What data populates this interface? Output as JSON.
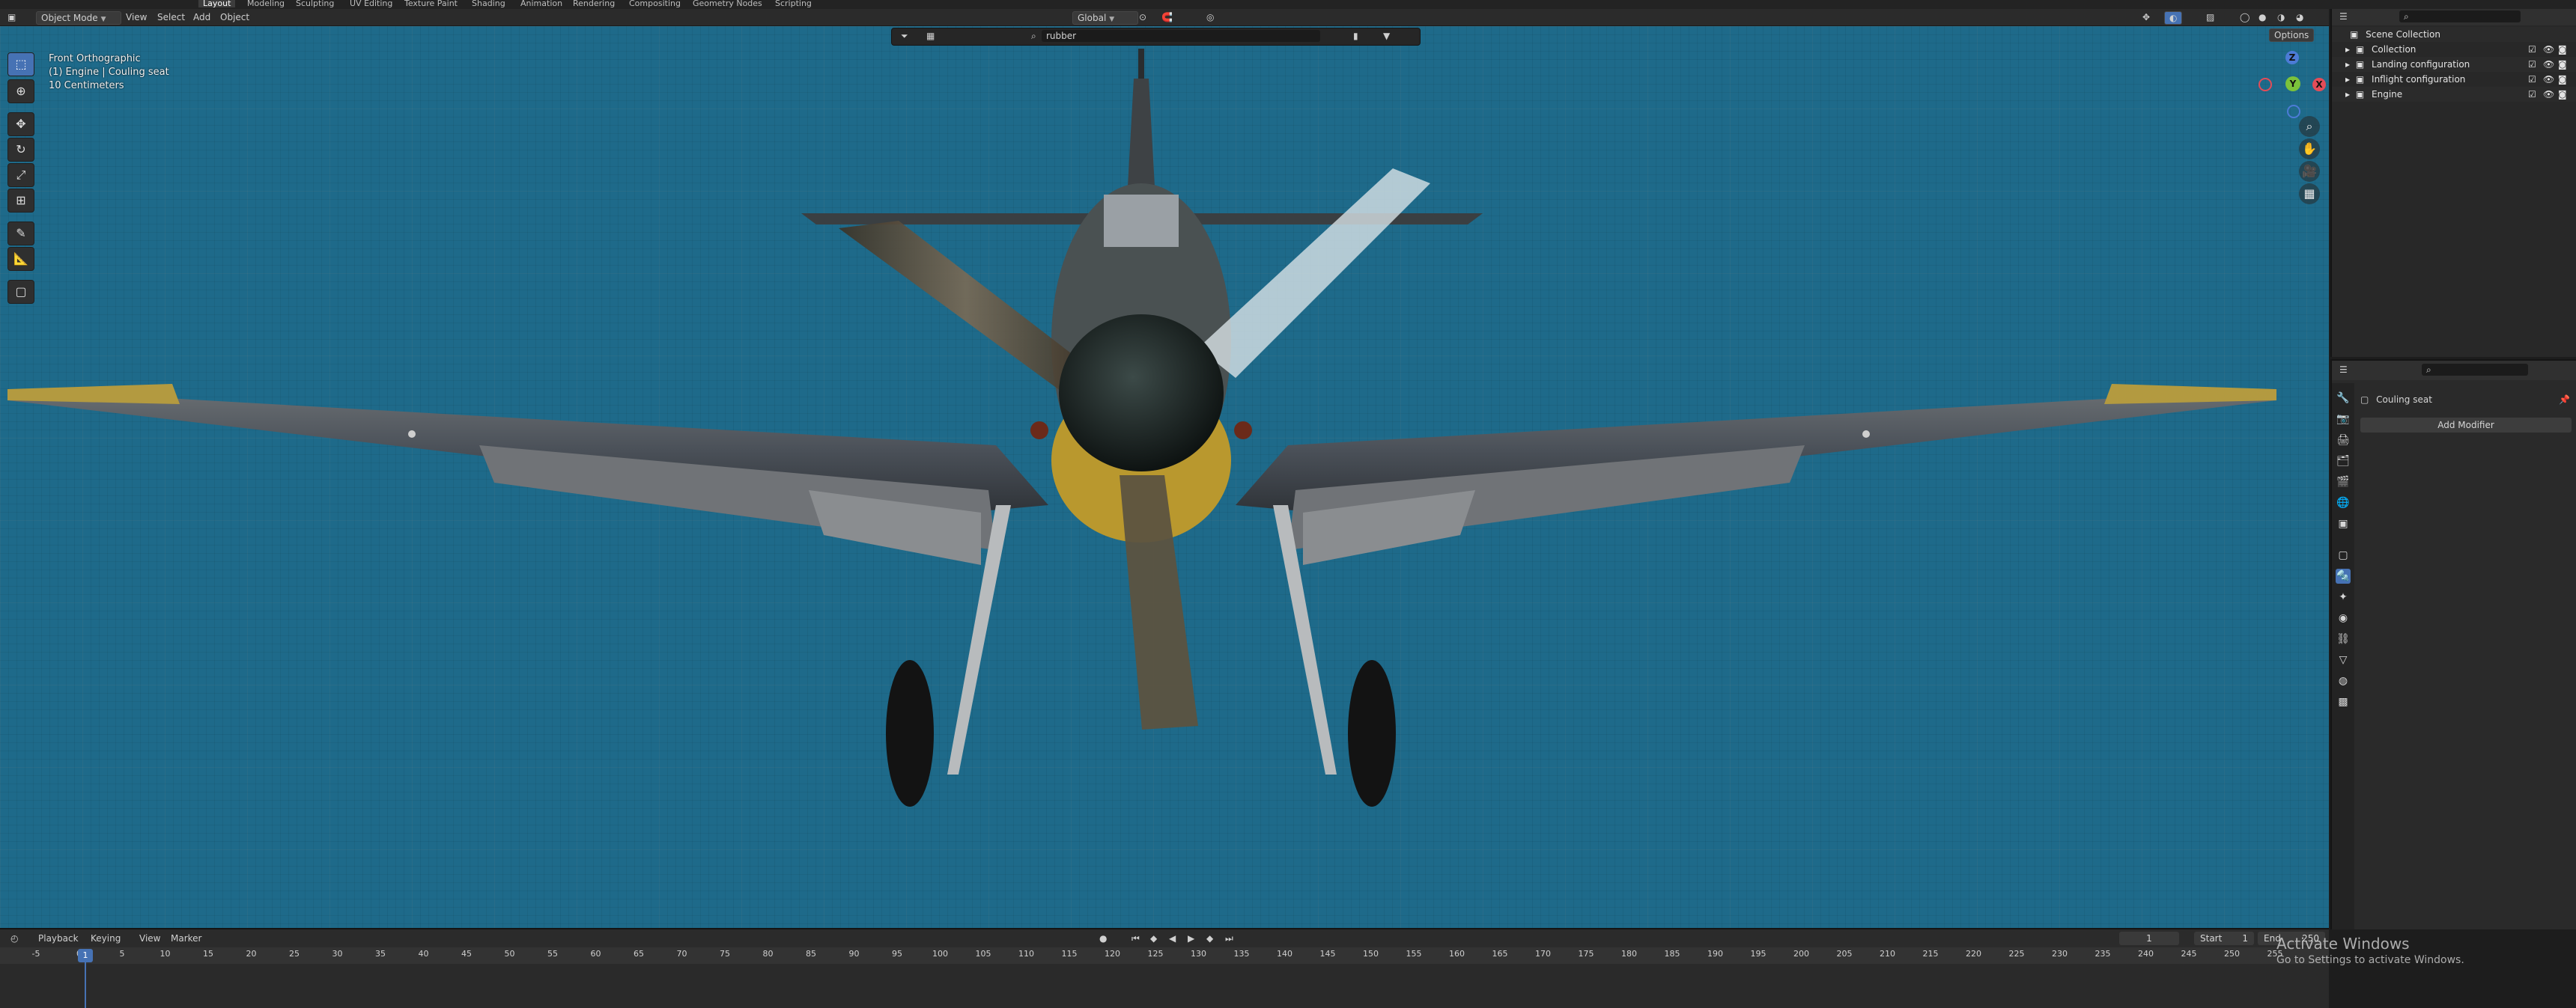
{
  "workspace_tabs": [
    "Layout",
    "Modeling",
    "Sculpting",
    "UV Editing",
    "Texture Paint",
    "Shading",
    "Animation",
    "Rendering",
    "Compositing",
    "Geometry Nodes",
    "Scripting"
  ],
  "viewport_header": {
    "mode": "Object Mode",
    "menus": [
      "View",
      "Select",
      "Add",
      "Object"
    ],
    "transform_orientation": "Global",
    "options_label": "Options"
  },
  "filter": {
    "search_value": "rubber"
  },
  "viewport_info": {
    "view_name": "Front Orthographic",
    "object_info": "(1) Engine | Couling seat",
    "scale": "10 Centimeters"
  },
  "gizmo": {
    "z": "Z",
    "y": "Y",
    "x": "X"
  },
  "outliner": {
    "root": "Scene Collection",
    "items": [
      {
        "label": "Collection"
      },
      {
        "label": "Landing configuration"
      },
      {
        "label": "Inflight configuration"
      },
      {
        "label": "Engine"
      }
    ]
  },
  "properties": {
    "object_name": "Couling seat",
    "add_modifier_label": "Add Modifier"
  },
  "timeline": {
    "menus": [
      "Playback",
      "Keying",
      "View",
      "Marker"
    ],
    "current_frame": "1",
    "start_label": "Start",
    "start_value": "1",
    "end_label": "End",
    "end_value": "250",
    "ticks": [
      "-5",
      "0",
      "5",
      "10",
      "15",
      "20",
      "25",
      "30",
      "35",
      "40",
      "45",
      "50",
      "55",
      "60",
      "65",
      "70",
      "75",
      "80",
      "85",
      "90",
      "95",
      "100",
      "105",
      "110",
      "115",
      "120",
      "125",
      "130",
      "135",
      "140",
      "145",
      "150",
      "155",
      "160",
      "165",
      "170",
      "175",
      "180",
      "185",
      "190",
      "195",
      "200",
      "205",
      "210",
      "215",
      "220",
      "225",
      "230",
      "235",
      "240",
      "245",
      "250",
      "255"
    ]
  },
  "watermark": {
    "line1": "Activate Windows",
    "line2": "Go to Settings to activate Windows."
  },
  "colors": {
    "viewport_bg": "#1e6a8a",
    "accent": "#4672b4",
    "panel": "#2a2a2a"
  }
}
